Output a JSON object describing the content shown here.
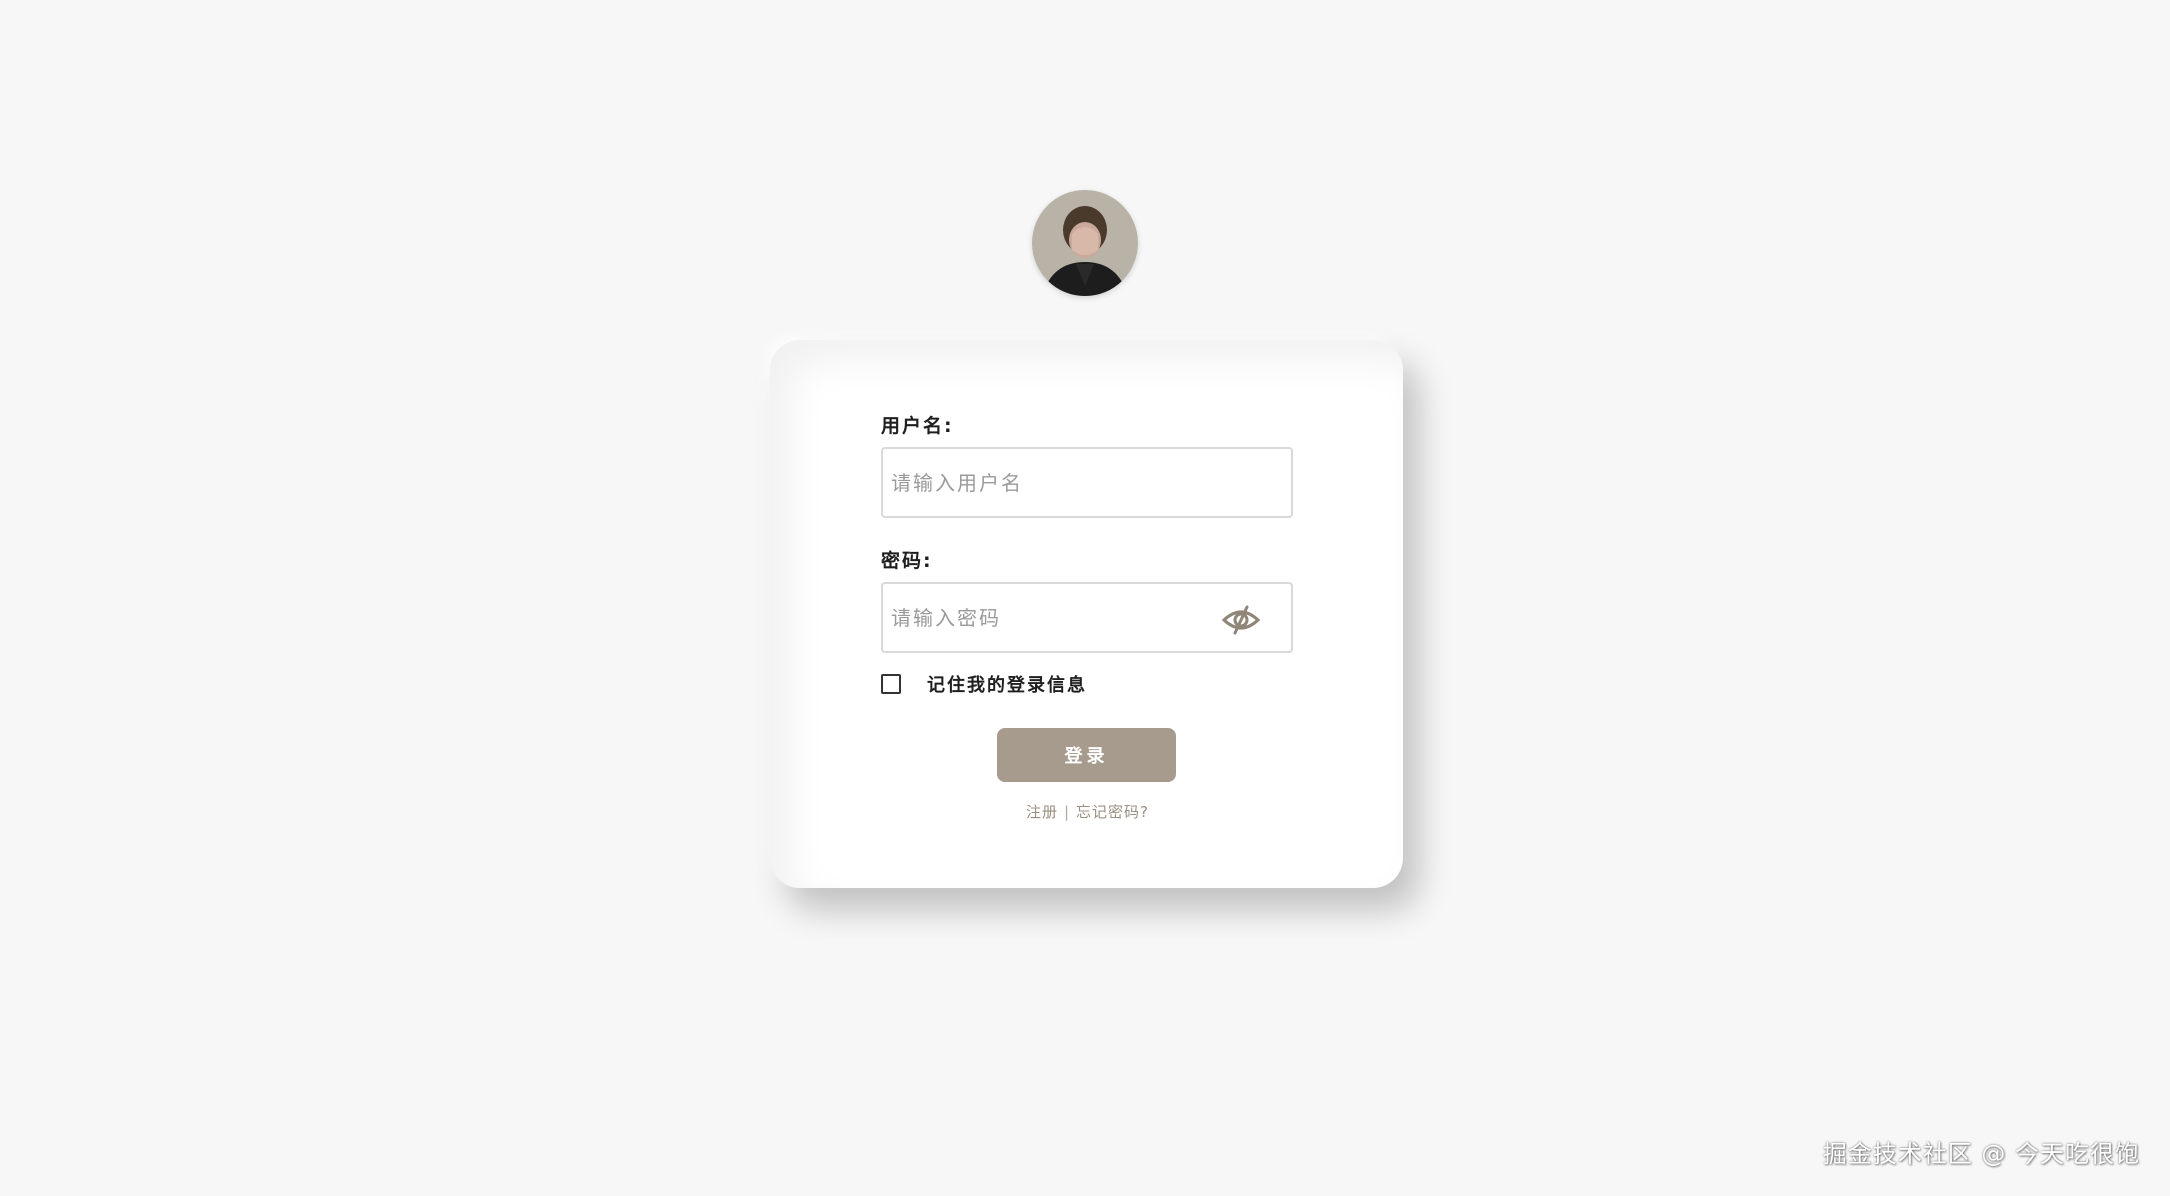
{
  "form": {
    "username_label": "用户名:",
    "username_placeholder": "请输入用户名",
    "username_value": "",
    "password_label": "密码:",
    "password_placeholder": "请输入密码",
    "password_value": "",
    "remember_label": "记住我的登录信息",
    "remember_checked": false,
    "login_button": "登录",
    "register_link": "注册",
    "link_separator": "|",
    "forgot_link": "忘记密码?"
  },
  "icons": {
    "avatar": "avatar-photo",
    "password_toggle": "eye-slash-icon"
  },
  "colors": {
    "background": "#f7f7f7",
    "card": "#ffffff",
    "button": "#a69b8c",
    "link": "#9a8f80"
  },
  "watermark": "掘金技术社区 @ 今天吃很饱"
}
